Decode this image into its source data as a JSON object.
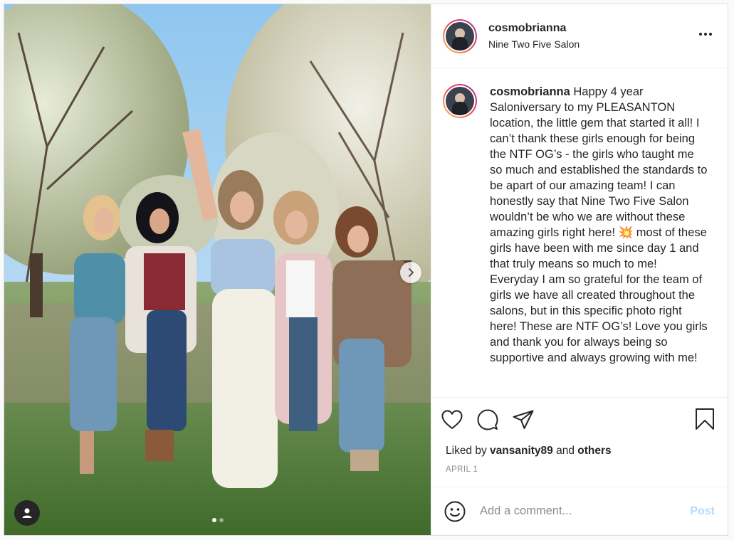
{
  "post": {
    "username": "cosmobrianna",
    "location": "Nine Two Five Salon",
    "caption_username": "cosmobrianna",
    "caption_text": "Happy 4 year Saloniversary to my PLEASANTON location, the little gem that started it all! I can’t thank these girls enough for being the NTF OG’s - the girls who taught me so much and established the standards to be apart of our amazing team! I can honestly say that Nine Two Five Salon wouldn’t be who we are without these amazing girls right here! 💥 most of these girls have been with me since day 1 and that truly means so much to me! Everyday I am so grateful for the team of girls we have all created throughout the salons, but in this specific photo right here! These are NTF OG’s! Love you girls and thank you for always being so supportive and always growing with me!",
    "liked_by_prefix": "Liked by",
    "liked_by_user": "vansanity89",
    "liked_by_and": "and",
    "liked_by_others": "others",
    "date": "APRIL 1",
    "carousel_index": 1,
    "carousel_count": 2
  },
  "comment": {
    "placeholder": "Add a comment...",
    "post_label": "Post"
  },
  "icons": {
    "more": "more-options-icon",
    "like": "heart-icon",
    "comment": "comment-icon",
    "share": "share-icon",
    "save": "bookmark-icon",
    "emoji": "emoji-icon",
    "next": "chevron-right-icon",
    "tags": "user-tag-icon"
  },
  "colors": {
    "border": "#dbdbdb",
    "text": "#262626",
    "muted": "#8e8e8e",
    "post_button_disabled": "#b3dbff"
  }
}
